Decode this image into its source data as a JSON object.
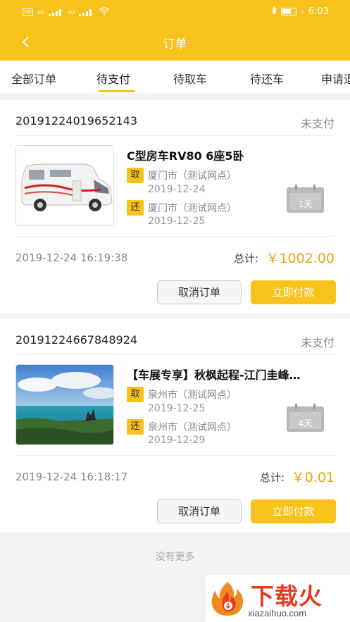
{
  "status_bar": {
    "hd_label": "HD",
    "signal1_label": "4G",
    "signal2_label": "4G",
    "battery_label": "2",
    "time": "6:03"
  },
  "header": {
    "title": "订单"
  },
  "tabs": [
    {
      "label": "全部订单",
      "active": false
    },
    {
      "label": "待支付",
      "active": true
    },
    {
      "label": "待取车",
      "active": false
    },
    {
      "label": "待还车",
      "active": false
    },
    {
      "label": "申请退",
      "active": false
    }
  ],
  "orders": [
    {
      "order_no": "20191224019652143",
      "status": "未支付",
      "car_name": "C型房车RV80 6座5卧",
      "pickup_tag": "取",
      "pickup_location": "厦门市（测试网点）",
      "pickup_date": "2019-12-24",
      "return_tag": "还",
      "return_location": "厦门市（测试网点）",
      "return_date": "2019-12-25",
      "days": "1天",
      "created_at": "2019-12-24 16:19:38",
      "total_label": "总计:",
      "total_value": "￥1002.00",
      "cancel_label": "取消订单",
      "pay_label": "立即付款"
    },
    {
      "order_no": "20191224667848924",
      "status": "未支付",
      "car_name": "【车展专享】秋枫起程-江门圭峰…",
      "pickup_tag": "取",
      "pickup_location": "泉州市（测试网点）",
      "pickup_date": "2019-12-25",
      "return_tag": "还",
      "return_location": "泉州市（测试网点）",
      "return_date": "2019-12-29",
      "days": "4天",
      "created_at": "2019-12-24 16:18:17",
      "total_label": "总计:",
      "total_value": "￥0.01",
      "cancel_label": "取消订单",
      "pay_label": "立即付款"
    }
  ],
  "footer": {
    "no_more": "没有更多"
  },
  "watermark": {
    "title": "下载火",
    "url": "xiazaihuo.com"
  },
  "colors": {
    "accent": "#f7c21a",
    "price": "#f0a20a",
    "watermark_red": "#e63a1e"
  }
}
